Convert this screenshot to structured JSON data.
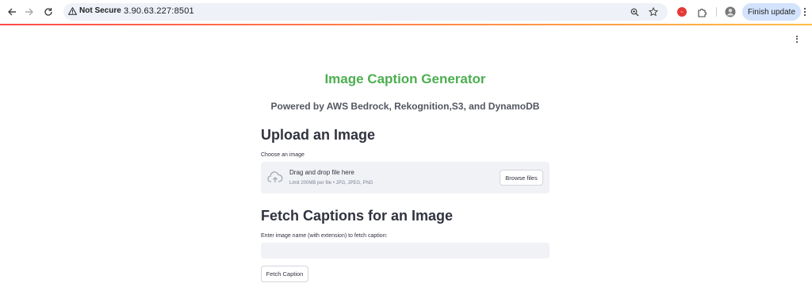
{
  "browser": {
    "security_label": "Not Secure",
    "url": "3.90.63.227:8501",
    "finish_update_label": "Finish update",
    "icons": [
      "back-icon",
      "forward-icon",
      "reload-icon",
      "warning-icon",
      "zoom-icon",
      "bookmark-star-icon",
      "extension-badge-icon",
      "puzzle-extensions-icon",
      "profile-avatar",
      "browser-menu-icon"
    ]
  },
  "colors": {
    "title_green": "#4caf50",
    "widget_bg": "#f0f2f6",
    "text": "#31333f",
    "progress_gradient_start": "#ff4b4b",
    "progress_gradient_end": "#ffbd45"
  },
  "app": {
    "title": "Image Caption Generator",
    "subtitle": "Powered by AWS Bedrock, Rekognition,S3, and DynamoDB"
  },
  "upload": {
    "heading": "Upload an Image",
    "label": "Choose an image",
    "drop_text": "Drag and drop file here",
    "limit_text": "Limit 200MB per file • JPG, JPEG, PNG",
    "browse_label": "Browse files"
  },
  "fetch": {
    "heading": "Fetch Captions for an Image",
    "label": "Enter image name (with extension) to fetch caption:",
    "input_value": "",
    "button_label": "Fetch Caption"
  }
}
